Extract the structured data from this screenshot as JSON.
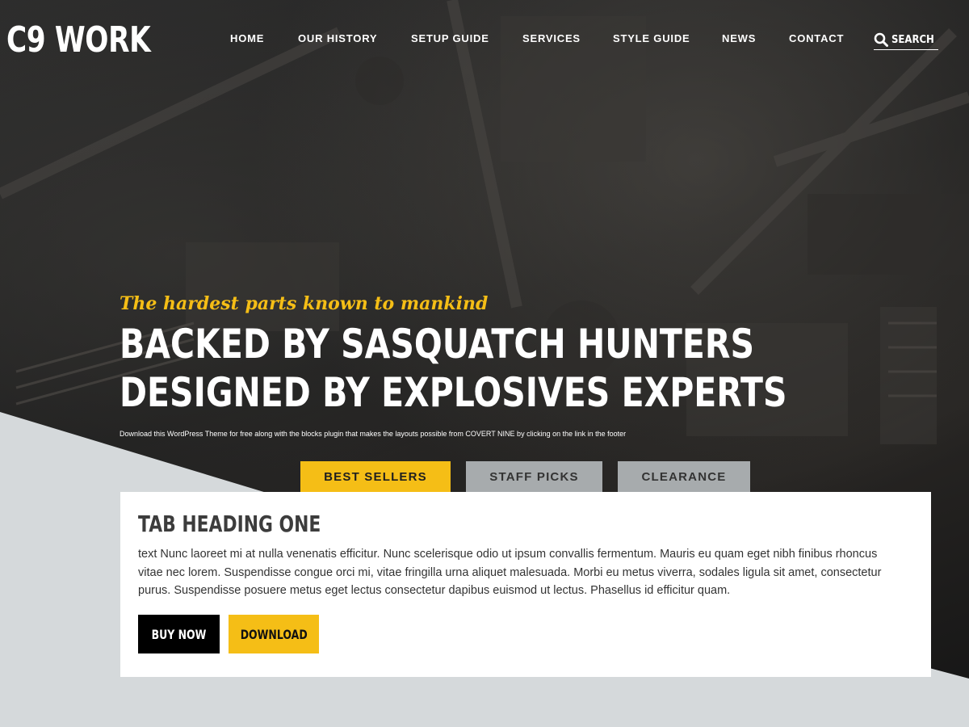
{
  "header": {
    "logo": "C9 WORK",
    "nav": [
      {
        "label": "HOME"
      },
      {
        "label": "OUR HISTORY"
      },
      {
        "label": "SETUP GUIDE"
      },
      {
        "label": "SERVICES"
      },
      {
        "label": "STYLE GUIDE"
      },
      {
        "label": "NEWS"
      },
      {
        "label": "CONTACT"
      }
    ],
    "search": {
      "placeholder": "SEARCH",
      "icon": "search-icon"
    }
  },
  "hero": {
    "tagline": "The hardest parts known to mankind",
    "headline_line1": "BACKED BY SASQUATCH HUNTERS",
    "headline_line2": "DESIGNED BY EXPLOSIVES EXPERTS",
    "subtext": "Download this WordPress Theme for free along with the blocks plugin that makes the layouts possible from COVERT NINE by clicking on the link in the footer"
  },
  "tabs": [
    {
      "label": "BEST SELLERS",
      "active": true
    },
    {
      "label": "STAFF PICKS",
      "active": false
    },
    {
      "label": "CLEARANCE",
      "active": false
    }
  ],
  "panel": {
    "heading": "TAB HEADING ONE",
    "body": "text  Nunc laoreet mi at nulla venenatis efficitur. Nunc scelerisque odio ut ipsum convallis fermentum. Mauris eu quam eget nibh finibus rhoncus vitae nec lorem. Suspendisse congue orci mi, vitae fringilla urna aliquet malesuada. Morbi eu metus viverra, sodales ligula sit amet, consectetur purus. Suspendisse posuere metus eget lectus consectetur dapibus euismod ut lectus. Phasellus id efficitur quam.",
    "buy_label": "BUY NOW",
    "download_label": "DOWNLOAD"
  },
  "colors": {
    "accent": "#f5be16",
    "tab_inactive": "#a7abad",
    "page_background": "#d5d9db",
    "hero_dark": "#1c1c1c"
  }
}
